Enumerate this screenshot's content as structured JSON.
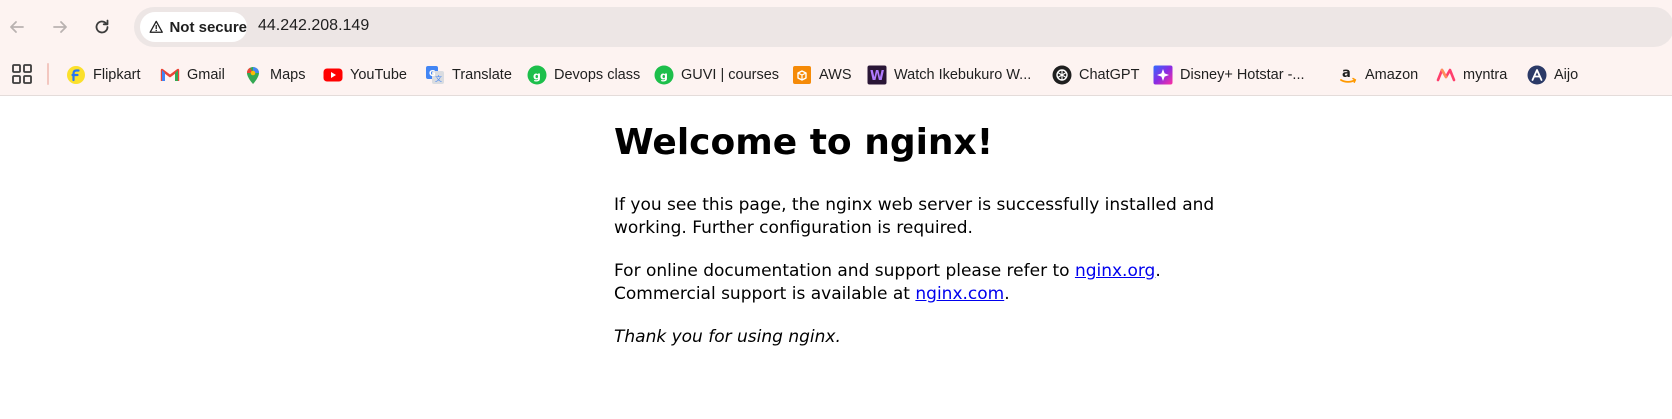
{
  "browser": {
    "security_label": "Not secure",
    "url": "44.242.208.149",
    "bookmarks": [
      {
        "label": "Flipkart",
        "icon": "flipkart-icon",
        "color": "#2874f0"
      },
      {
        "label": "Gmail",
        "icon": "gmail-icon",
        "color": "#ea4335"
      },
      {
        "label": "Maps",
        "icon": "maps-icon",
        "color": "#34a853"
      },
      {
        "label": "YouTube",
        "icon": "youtube-icon",
        "color": "#ff0000"
      },
      {
        "label": "Translate",
        "icon": "translate-icon",
        "color": "#4285f4"
      },
      {
        "label": "Devops class",
        "icon": "guvi-icon",
        "color": "#1dbf4b"
      },
      {
        "label": "GUVI | courses",
        "icon": "guvi-icon",
        "color": "#1dbf4b"
      },
      {
        "label": "AWS",
        "icon": "aws-icon",
        "color": "#f58a07"
      },
      {
        "label": "Watch Ikebukuro W...",
        "icon": "watch-icon",
        "color": "#3b1f4a"
      },
      {
        "label": "ChatGPT",
        "icon": "chatgpt-icon",
        "color": "#000000"
      },
      {
        "label": "Disney+ Hotstar -...",
        "icon": "hotstar-icon",
        "color": "#5c2bd6"
      },
      {
        "label": "Amazon",
        "icon": "amazon-icon",
        "color": "#ff9900"
      },
      {
        "label": "myntra",
        "icon": "myntra-icon",
        "color": "#ff3f6c"
      },
      {
        "label": "Aijo",
        "icon": "aijo-icon",
        "color": "#2b3a67"
      }
    ]
  },
  "page": {
    "heading": "Welcome to nginx!",
    "para1": "If you see this page, the nginx web server is successfully installed and working. Further configuration is required.",
    "para2_prefix": "For online documentation and support please refer to ",
    "link_org": "nginx.org",
    "para2_mid": ".",
    "para2_line2_prefix": "Commercial support is available at ",
    "link_com": "nginx.com",
    "para2_end": ".",
    "para3": "Thank you for using nginx."
  }
}
